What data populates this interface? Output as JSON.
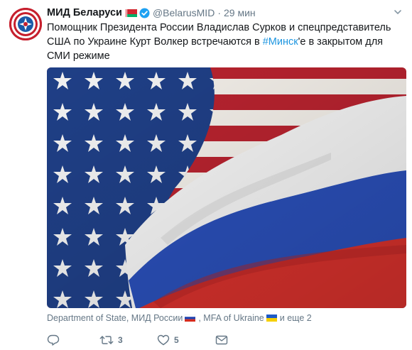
{
  "tweet": {
    "author_name": "МИД Беларуси",
    "username": "@BelarusMID",
    "separator": "·",
    "time": "29 мин",
    "text_before": "Помощник Президента России Владислав Сурков и спецпредставитель США по Украине Курт Волкер встречаются в ",
    "hashtag": "#Минск",
    "text_after": "'е в закрытом для СМИ режиме",
    "mentions": {
      "first": "Department of State, МИД России",
      "second": ", MFA of Ukraine",
      "more": "и еще 2"
    },
    "actions": {
      "reply_count": "",
      "retweet_count": "3",
      "like_count": "5"
    }
  },
  "icons": {
    "avatar": "mfa-belarus-emblem",
    "author_flag": "belarus-flag",
    "verified": "verified-badge",
    "caret": "chevron-down-icon",
    "mention_flag_1": "russia-flag",
    "mention_flag_2": "ukraine-flag",
    "reply": "reply-icon",
    "retweet": "retweet-icon",
    "like": "heart-icon",
    "dm": "envelope-icon"
  },
  "colors": {
    "link": "#1b95e0",
    "secondary_text": "#657786",
    "primary_text": "#14171a",
    "verified_blue": "#1da1f2"
  }
}
